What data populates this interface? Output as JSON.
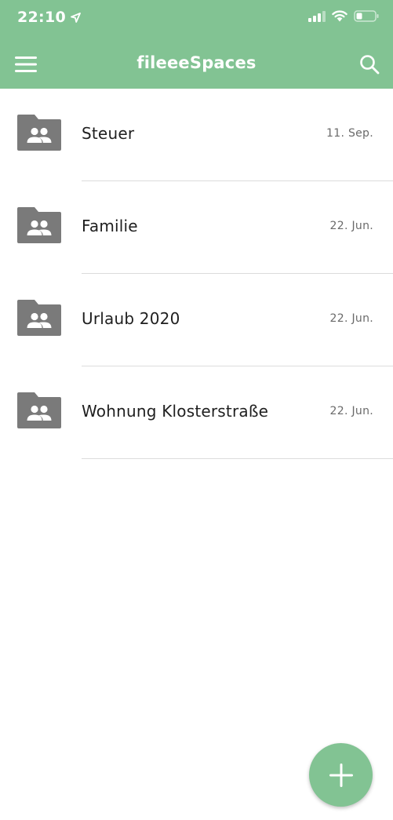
{
  "status_bar": {
    "time": "22:10",
    "icons": [
      "location-arrow-icon",
      "cellular-signal-icon",
      "wifi-icon",
      "battery-icon"
    ]
  },
  "header": {
    "title": "fileeeSpaces",
    "menu_icon": "hamburger-menu-icon",
    "search_icon": "search-icon"
  },
  "spaces": [
    {
      "name": "Steuer",
      "date": "11. Sep.",
      "icon": "shared-folder-icon"
    },
    {
      "name": "Familie",
      "date": "22. Jun.",
      "icon": "shared-folder-icon"
    },
    {
      "name": "Urlaub 2020",
      "date": "22. Jun.",
      "icon": "shared-folder-icon"
    },
    {
      "name": "Wohnung Klosterstraße",
      "date": "22. Jun.",
      "icon": "shared-folder-icon"
    }
  ],
  "fab": {
    "icon": "plus-icon"
  },
  "colors": {
    "accent": "#82c393",
    "folder": "#7a7a7a",
    "text": "#1f1f1f",
    "date": "#6a6a6a",
    "divider": "#dcdcdc"
  }
}
